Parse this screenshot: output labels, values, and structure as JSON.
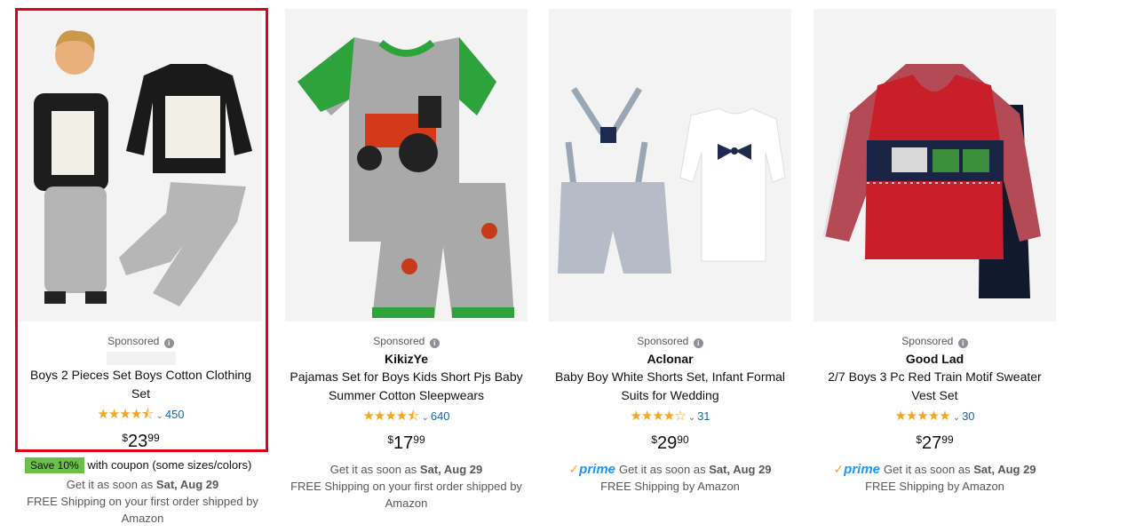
{
  "products": [
    {
      "sponsored_label": "Sponsored",
      "brand": "",
      "title": "Boys 2 Pieces Set Boys Cotton Clothing Set",
      "rating_stars": 4.5,
      "rating_count": "450",
      "price_symbol": "$",
      "price_whole": "23",
      "price_fraction": "99",
      "save_badge": "Save 10%",
      "coupon_text": "with coupon (some sizes/colors)",
      "delivery_prefix": "Get it as soon as",
      "delivery_date": "Sat, Aug 29",
      "shipping_text": "FREE Shipping on your first order shipped by Amazon",
      "prime": false,
      "image_icon": "boys-clothing-set-photo"
    },
    {
      "sponsored_label": "Sponsored",
      "brand": "KikizYe",
      "title": "Pajamas Set for Boys Kids Short Pjs Baby Summer Cotton Sleepwears",
      "rating_stars": 4.5,
      "rating_count": "640",
      "price_symbol": "$",
      "price_whole": "17",
      "price_fraction": "99",
      "delivery_prefix": "Get it as soon as",
      "delivery_date": "Sat, Aug 29",
      "shipping_text": "FREE Shipping on your first order shipped by Amazon",
      "prime": false,
      "image_icon": "tractor-pajama-photo"
    },
    {
      "sponsored_label": "Sponsored",
      "brand": "Aclonar",
      "title": "Baby Boy White Shorts Set, Infant Formal Suits for Wedding",
      "rating_stars": 4.0,
      "rating_count": "31",
      "price_symbol": "$",
      "price_whole": "29",
      "price_fraction": "90",
      "prime_label": "prime",
      "delivery_prefix": "Get it as soon as",
      "delivery_date": "Sat, Aug 29",
      "shipping_text": "FREE Shipping by Amazon",
      "prime": true,
      "image_icon": "suspender-shorts-photo"
    },
    {
      "sponsored_label": "Sponsored",
      "brand": "Good Lad",
      "title": "2/7 Boys 3 Pc Red Train Motif Sweater Vest Set",
      "rating_stars": 5.0,
      "rating_count": "30",
      "price_symbol": "$",
      "price_whole": "27",
      "price_fraction": "99",
      "prime_label": "prime",
      "delivery_prefix": "Get it as soon as",
      "delivery_date": "Sat, Aug 29",
      "shipping_text": "FREE Shipping by Amazon",
      "prime": true,
      "image_icon": "train-sweater-vest-photo"
    }
  ],
  "colors": {
    "highlight": "#e3001b",
    "star": "#f5a623",
    "link": "#2162a1",
    "prime": "#1a98ff",
    "save_badge": "#6dbf4b"
  }
}
